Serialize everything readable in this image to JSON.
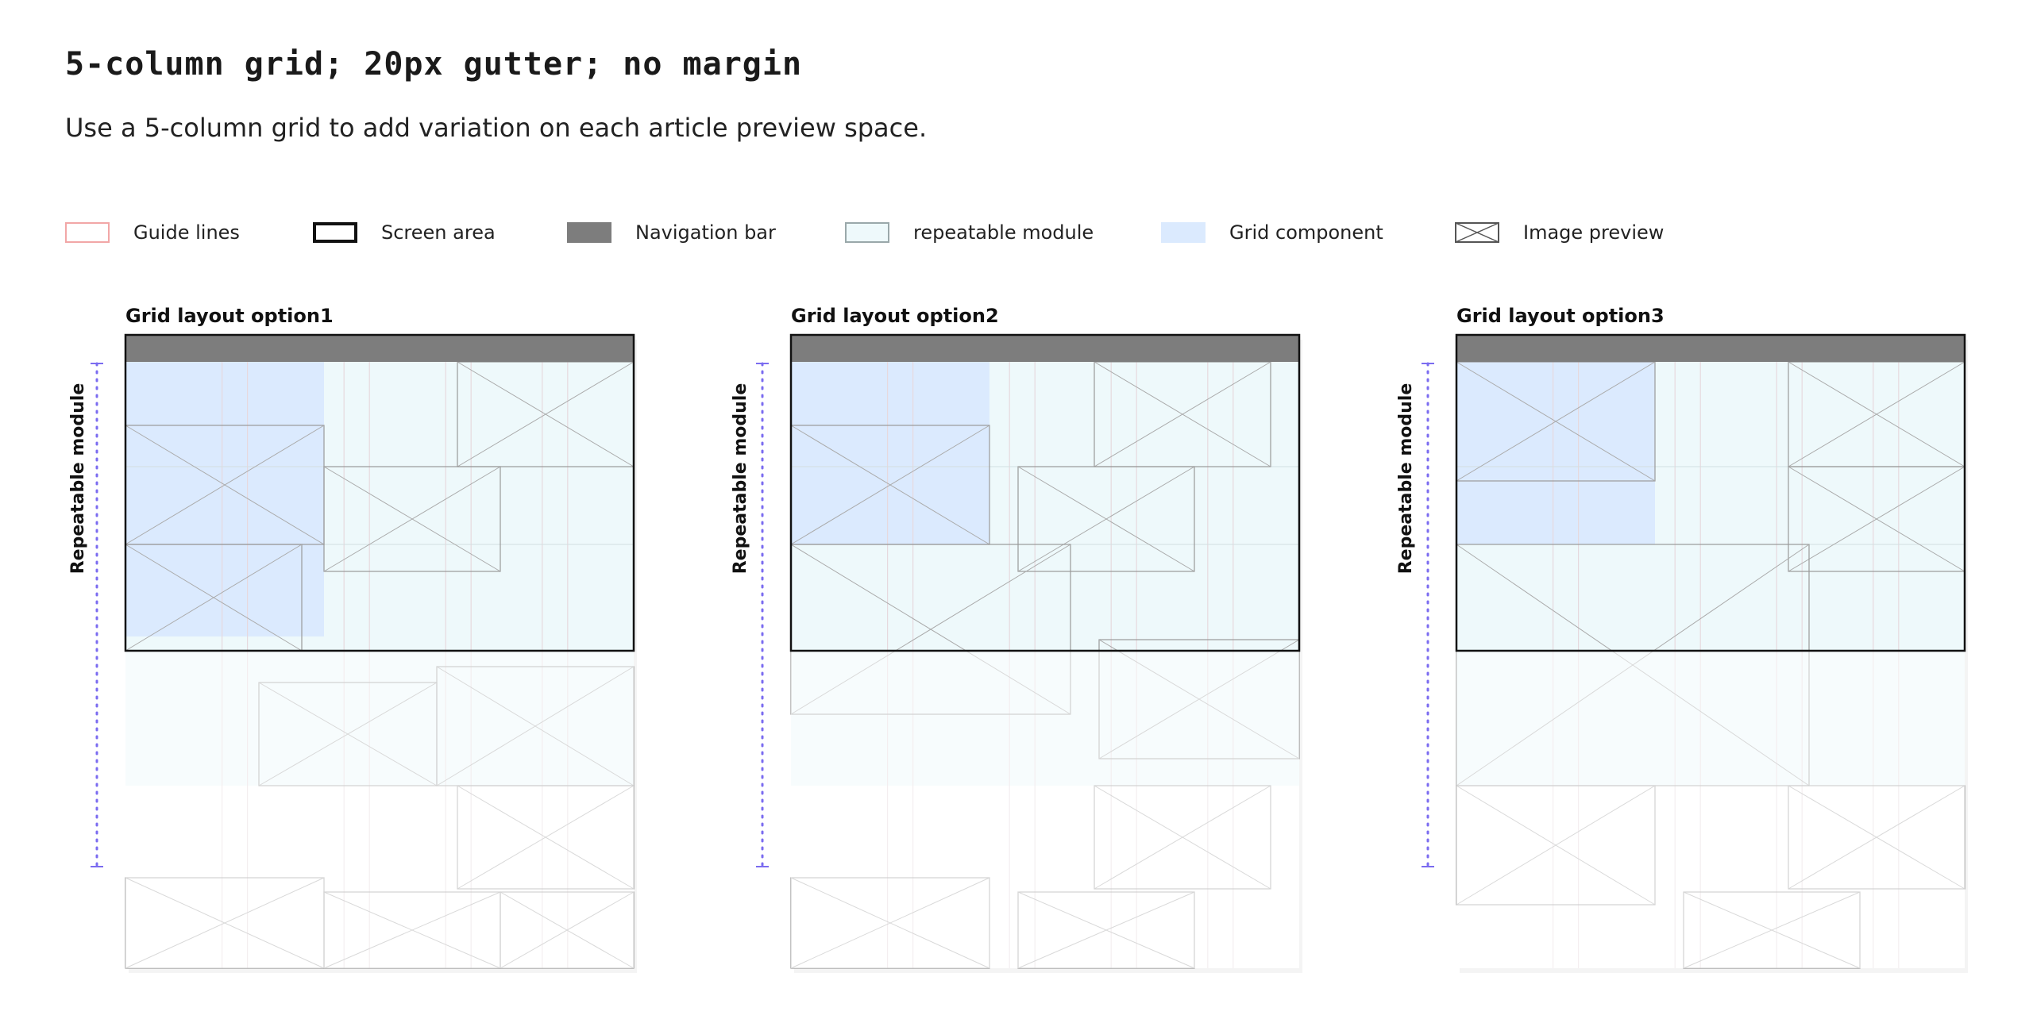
{
  "header": {
    "title": "5-column grid; 20px gutter; no margin",
    "subtitle": "Use a 5-column grid to add variation on each article preview space."
  },
  "legend": [
    {
      "key": "guide",
      "label": "Guide lines",
      "color": "#f2a7a7"
    },
    {
      "key": "screen",
      "label": "Screen area",
      "color": "#111111"
    },
    {
      "key": "nav",
      "label": "Navigation bar",
      "color": "#7d7d7d"
    },
    {
      "key": "module",
      "label": "repeatable module",
      "color": "#eef9fb"
    },
    {
      "key": "grid",
      "label": "Grid component",
      "color": "#dbeafe"
    },
    {
      "key": "image",
      "label": "Image preview",
      "color": "#555555"
    }
  ],
  "panels": [
    {
      "title": "Grid layout option1",
      "repeat_label": "Repeatable module"
    },
    {
      "title": "Grid layout option2",
      "repeat_label": "Repeatable module"
    },
    {
      "title": "Grid layout option3",
      "repeat_label": "Repeatable module"
    }
  ],
  "colors": {
    "nav": "#7d7d7d",
    "module": "#eef9fb",
    "grid_component": "#dbeafe",
    "repeat_marker": "#7b6cf0",
    "screen_border": "#111111"
  }
}
